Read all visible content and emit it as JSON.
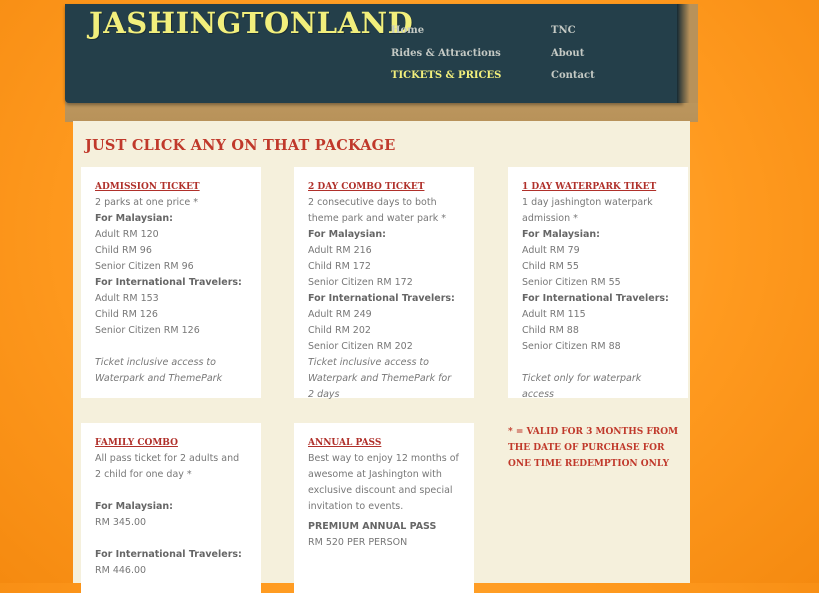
{
  "header": {
    "logo": "JASHINGTONLAND",
    "nav": [
      {
        "label": "Home"
      },
      {
        "label": "Rides & Attractions"
      },
      {
        "label": "TICKETS & PRICES",
        "active": true
      },
      {
        "label": "TNC"
      },
      {
        "label": "About"
      },
      {
        "label": "Contact"
      }
    ]
  },
  "main": {
    "title": "JUST CLICK ANY ON THAT PACKAGE",
    "cards": [
      {
        "title": "ADMISSION TICKET",
        "desc": "2 parks at one price *",
        "malaysian_label": "For Malaysian:",
        "malaysian": [
          "Adult RM 120",
          "Child RM 96",
          "Senior Citizen RM 96"
        ],
        "intl_label": "For International Travelers:",
        "intl": [
          "Adult RM 153",
          "Child RM 126",
          "Senior Citizen RM 126"
        ],
        "note": "Ticket inclusive access to Waterpark and ThemePark"
      },
      {
        "title": "2 DAY COMBO TICKET",
        "desc": "2 consecutive days to both theme park and water park *",
        "malaysian_label": "For Malaysian:",
        "malaysian": [
          "Adult RM 216",
          "Child RM 172",
          "Senior Citizen RM 172"
        ],
        "intl_label": "For International Travelers:",
        "intl": [
          "Adult RM 249",
          "Child RM 202",
          "Senior Citizen RM 202"
        ],
        "note": "Ticket inclusive access to Waterpark and ThemePark for 2 days"
      },
      {
        "title": "1 DAY WATERPARK TIKET",
        "desc": "1 day jashington waterpark admission *",
        "malaysian_label": "For Malaysian:",
        "malaysian": [
          "Adult RM 79",
          "Child RM 55",
          "Senior Citizen RM 55"
        ],
        "intl_label": "For International Travelers:",
        "intl": [
          "Adult RM 115",
          "Child RM 88",
          "Senior Citizen RM 88"
        ],
        "note": "Ticket only for waterpark access"
      },
      {
        "title": "FAMILY COMBO",
        "desc": "All pass ticket for 2 adults and 2 child for one day *",
        "malaysian_label": "For Malaysian:",
        "malaysian_price": "RM 345.00",
        "intl_label": "For International Travelers:",
        "intl_price": "RM 446.00"
      },
      {
        "title": "ANNUAL PASS",
        "desc": "Best way to enjoy 12 months of awesome at Jashington with exclusive discount and special invitation to events.",
        "premium_label": "PREMIUM ANNUAL PASS",
        "premium_price": "RM 520 PER PERSON"
      }
    ],
    "validity_note": "* = VALID FOR 3 MONTHS FROM THE DATE OF PURCHASE FOR ONE TIME REDEMPTION ONLY"
  }
}
